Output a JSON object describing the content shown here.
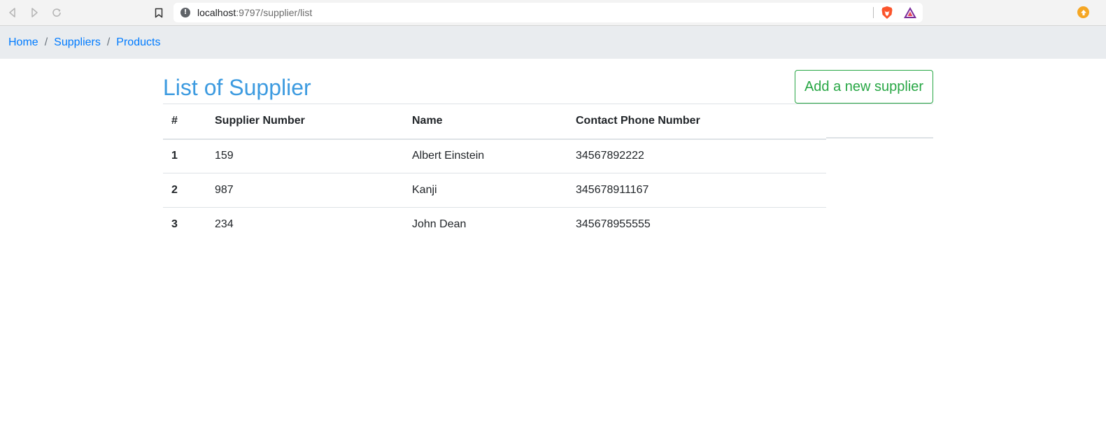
{
  "browser": {
    "url_host": "localhost",
    "url_path": ":9797/supplier/list",
    "icons": [
      "back-icon",
      "forward-icon",
      "reload-icon",
      "bookmark-icon",
      "site-info-icon",
      "brave-shields-icon",
      "brave-rewards-icon",
      "update-icon"
    ],
    "colors": {
      "toolbar": "#f3f3f3",
      "brave_orange": "#fb542b",
      "update": "#f5a623"
    }
  },
  "breadcrumb": {
    "items": [
      {
        "label": "Home"
      },
      {
        "label": "Suppliers"
      },
      {
        "label": "Products"
      }
    ],
    "separator": "/"
  },
  "page": {
    "title": "List of Supplier",
    "add_button_label": "Add a new supplier",
    "colors": {
      "title": "#3d9be0",
      "add_button": "#28a745",
      "link": "#007bff"
    }
  },
  "table": {
    "headers": [
      "#",
      "Supplier Number",
      "Name",
      "Contact Phone Number"
    ],
    "rows": [
      {
        "idx": "1",
        "number": "159",
        "name": "Albert Einstein",
        "phone": "34567892222"
      },
      {
        "idx": "2",
        "number": "987",
        "name": "Kanji",
        "phone": "345678911167"
      },
      {
        "idx": "3",
        "number": "234",
        "name": "John Dean",
        "phone": "345678955555"
      }
    ]
  }
}
